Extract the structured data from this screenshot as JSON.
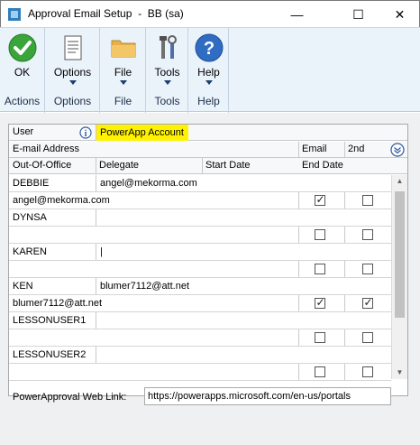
{
  "window": {
    "title": "Approval Email Setup  -  BB (sa)",
    "minimize": "—",
    "maximize": "☐",
    "close": "✕"
  },
  "ribbon": {
    "groups": [
      {
        "button": "OK",
        "group": "Actions",
        "icon": "check-icon"
      },
      {
        "button": "Options",
        "group": "Options",
        "icon": "document-icon"
      },
      {
        "button": "File",
        "group": "File",
        "icon": "folder-icon"
      },
      {
        "button": "Tools",
        "group": "Tools",
        "icon": "tools-icon"
      },
      {
        "button": "Help",
        "group": "Help",
        "icon": "help-icon"
      }
    ]
  },
  "grid": {
    "header": {
      "user": "User",
      "powerapp": "PowerApp Account",
      "email_address": "E-mail Address",
      "email": "Email",
      "second": "2nd",
      "out_of_office": "Out-Of-Office",
      "delegate": "Delegate",
      "start_date": "Start Date",
      "end_date": "End Date"
    },
    "rows": [
      {
        "user": "DEBBIE",
        "account": "angel@mekorma.com",
        "email_address": "angel@mekorma.com",
        "email": true,
        "second": false
      },
      {
        "user": "DYNSA",
        "account": "",
        "email_address": "",
        "email": false,
        "second": false
      },
      {
        "user": "KAREN",
        "account": "|",
        "email_address": "",
        "email": false,
        "second": false
      },
      {
        "user": "KEN",
        "account": "blumer7112@att.net",
        "email_address": "blumer7112@att.net",
        "email": true,
        "second": true
      },
      {
        "user": "LESSONUSER1",
        "account": "",
        "email_address": "",
        "email": false,
        "second": false
      },
      {
        "user": "LESSONUSER2",
        "account": "",
        "email_address": "",
        "email": false,
        "second": false
      }
    ]
  },
  "weblink": {
    "label": "PowerApproval Web Link:",
    "value": "https://powerapps.microsoft.com/en-us/portals"
  },
  "colors": {
    "highlight": "#fff200",
    "ribbon_bg": "#eaf2fa",
    "accent": "#2b6cb0"
  }
}
